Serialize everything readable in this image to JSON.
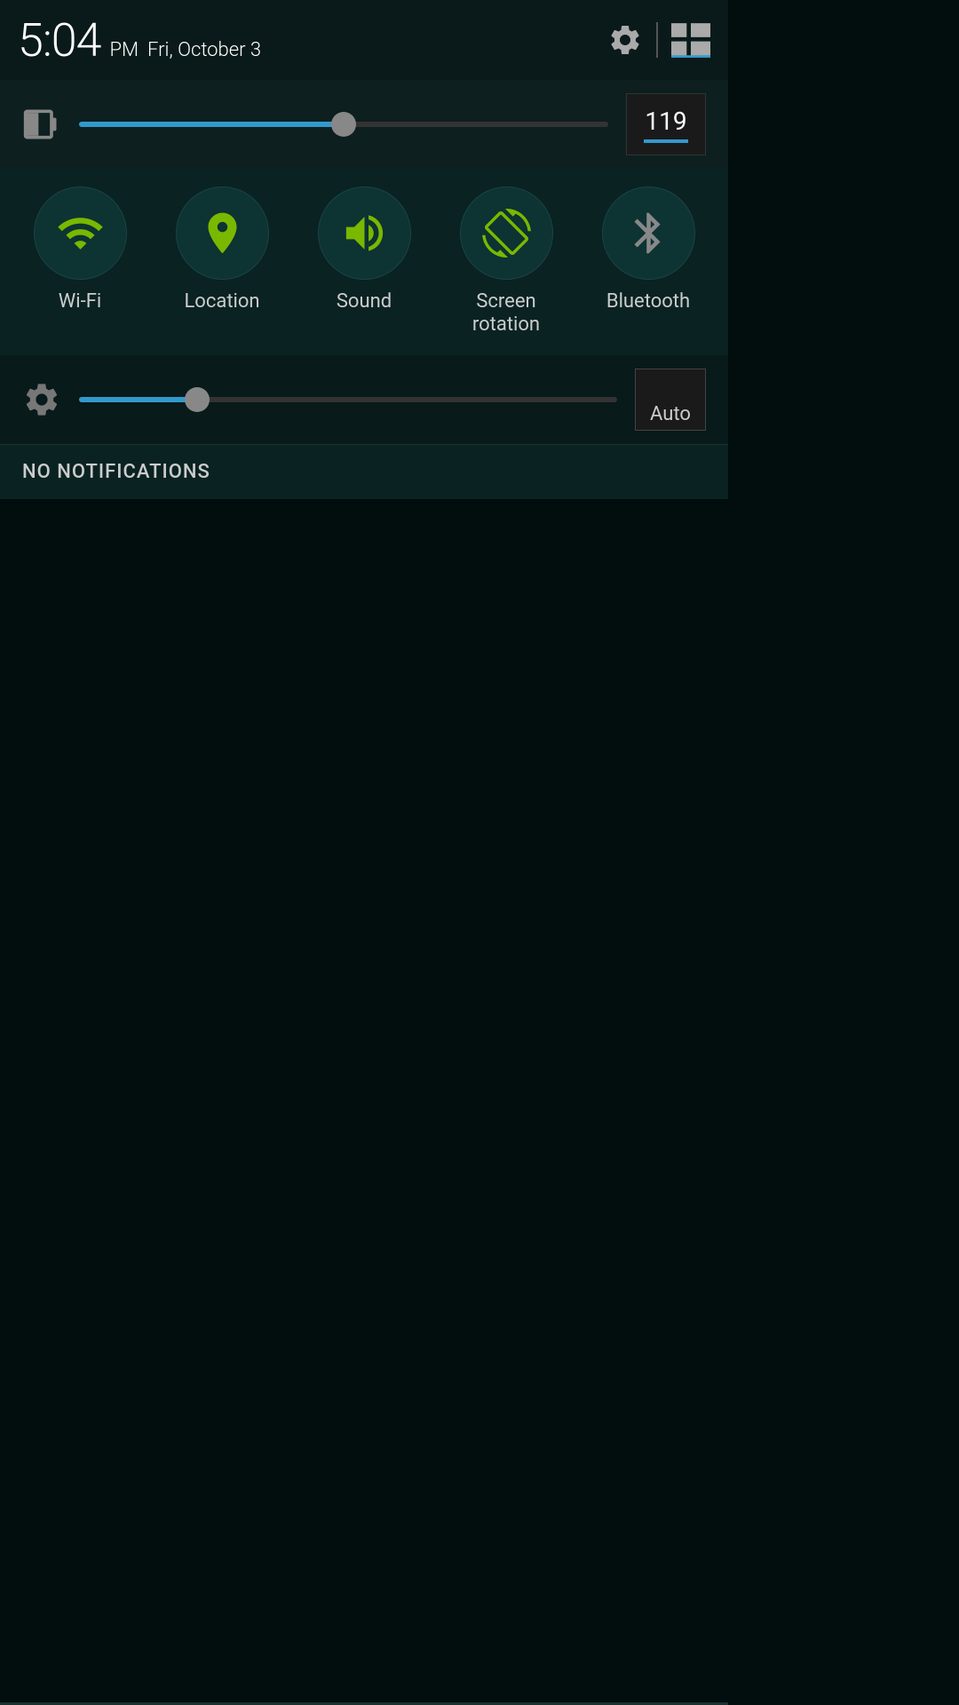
{
  "statusBar": {
    "time": "5:04",
    "ampm": "PM",
    "date": "Fri, October 3"
  },
  "brightness": {
    "value": "119",
    "fillPercent": 50
  },
  "toggles": [
    {
      "id": "wifi",
      "label": "Wi-Fi",
      "active": true
    },
    {
      "id": "location",
      "label": "Location",
      "active": true
    },
    {
      "id": "sound",
      "label": "Sound",
      "active": true
    },
    {
      "id": "screen-rotation",
      "label": "Screen rotation",
      "active": false
    },
    {
      "id": "bluetooth",
      "label": "Bluetooth",
      "active": false
    }
  ],
  "screenAdjust": {
    "autoLabel": "Auto",
    "fillPercent": 22
  },
  "notifications": {
    "emptyText": "NO NOTIFICATIONS"
  }
}
